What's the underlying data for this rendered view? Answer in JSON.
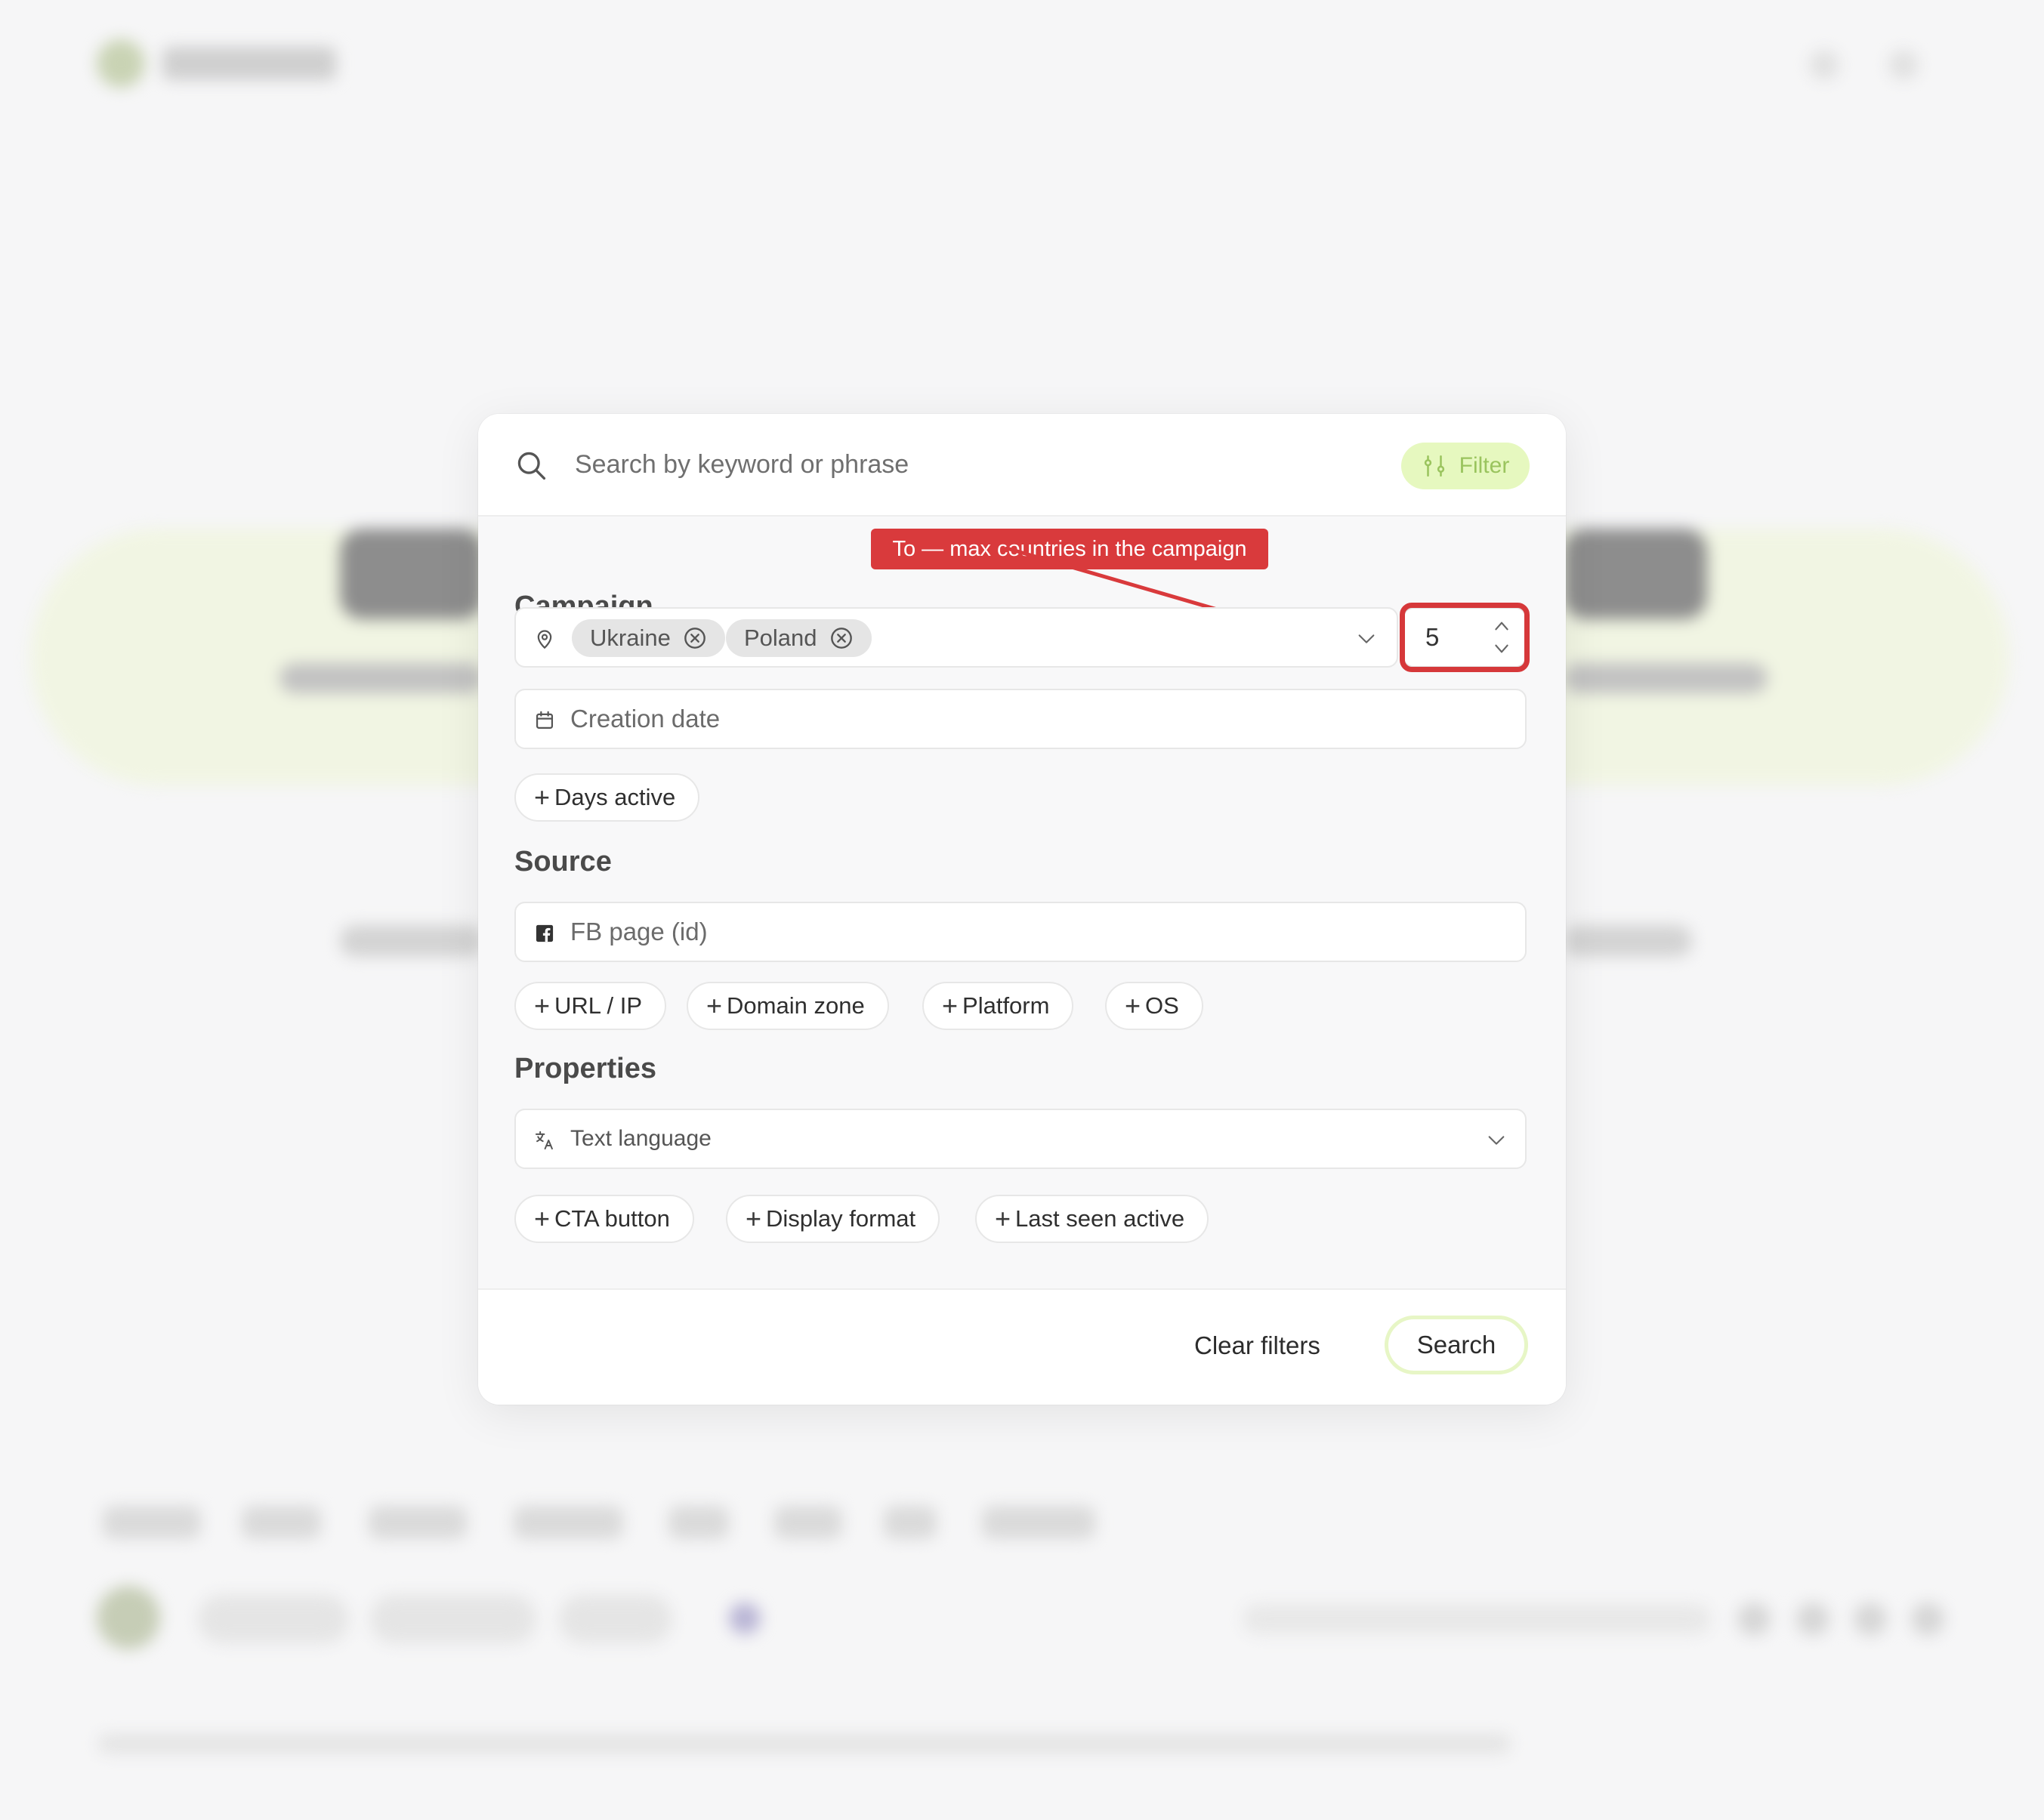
{
  "search": {
    "placeholder": "Search by keyword or phrase",
    "filter_label": "Filter"
  },
  "annotation": {
    "text": "To — max countries in the campaign"
  },
  "campaign": {
    "title": "Campaign",
    "countries": [
      "Ukraine",
      "Poland"
    ],
    "max_countries": "5",
    "creation_date_placeholder": "Creation date",
    "add_filters": [
      "Days active"
    ]
  },
  "source": {
    "title": "Source",
    "fb_page_placeholder": "FB page (id)",
    "add_filters": [
      "URL / IP",
      "Domain zone",
      "Platform",
      "OS"
    ]
  },
  "properties": {
    "title": "Properties",
    "text_language_placeholder": "Text language",
    "add_filters": [
      "CTA button",
      "Display format",
      "Last seen active"
    ]
  },
  "footer": {
    "clear_label": "Clear filters",
    "search_label": "Search"
  },
  "colors": {
    "accent_green": "#e6f8bf",
    "annotation_red": "#d93a3c"
  },
  "icons": {
    "search": "search-icon",
    "filter": "sliders-icon",
    "location": "map-pin-icon",
    "calendar": "calendar-icon",
    "facebook": "facebook-icon",
    "language": "translate-icon",
    "chip_remove": "close-circle-icon",
    "dropdown": "chevron-down-icon",
    "add": "plus-icon"
  }
}
